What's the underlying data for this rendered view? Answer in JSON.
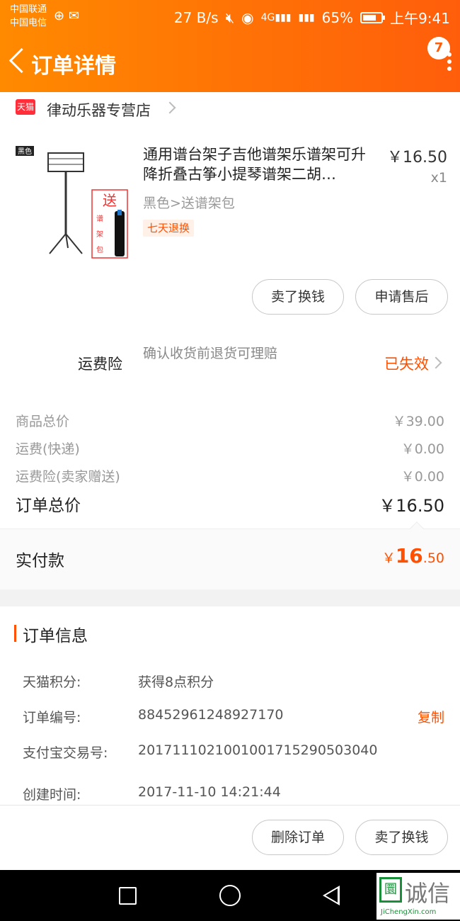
{
  "status_bar": {
    "carrier1": "中国联通",
    "carrier2": "中国电信",
    "net_speed": "27 B/s",
    "battery": "65%",
    "time": "上午9:41"
  },
  "nav": {
    "title": "订单详情",
    "badge_count": "7"
  },
  "store": {
    "icon_text": "天猫",
    "name": "律动乐器专营店"
  },
  "product": {
    "title": "通用谱台架子吉他谱架乐谱架可升降折叠古筝小提琴谱架二胡…",
    "price": "￥16.50",
    "quantity": "x1",
    "sku": "黑色>送谱架包",
    "tag": "七天退换",
    "image_label_color": "黑色",
    "image_label_gift": "送",
    "image_label_bag": "谱架包"
  },
  "product_actions": {
    "sell_button": "卖了换钱",
    "after_sale_button": "申请售后"
  },
  "insurance": {
    "label": "运费险",
    "description": "确认收货前退货可理赔",
    "status": "已失效"
  },
  "summary": {
    "rows": [
      {
        "label": "商品总价",
        "value": "￥39.00"
      },
      {
        "label": "运费(快递)",
        "value": "￥0.00"
      },
      {
        "label": "运费险(卖家赠送)",
        "value": "￥0.00"
      }
    ],
    "total_label": "订单总价",
    "total_value": "￥16.50"
  },
  "paid": {
    "label": "实付款",
    "currency": "￥",
    "integer": "16",
    "decimal": ".50"
  },
  "order_info": {
    "title": "订单信息",
    "rows": [
      {
        "key": "天猫积分:",
        "value": "获得8点积分"
      },
      {
        "key": "订单编号:",
        "value": "88452961248927170"
      },
      {
        "key": "支付宝交易号:",
        "value": "2017111021001001715290503040"
      },
      {
        "key": "创建时间:",
        "value": "2017-11-10 14:21:44"
      }
    ],
    "copy_label": "复制"
  },
  "footer": {
    "delete_button": "删除订单",
    "sell_button": "卖了换钱"
  },
  "watermark": {
    "text": "诚信",
    "sub": "JiChengXin.com",
    "box": "圜"
  },
  "colors": {
    "header_gradient_start": "#ff8a00",
    "header_gradient_end": "#ff5d0b",
    "accent": "#ff5000",
    "tmall_red": "#ff2e3a"
  }
}
